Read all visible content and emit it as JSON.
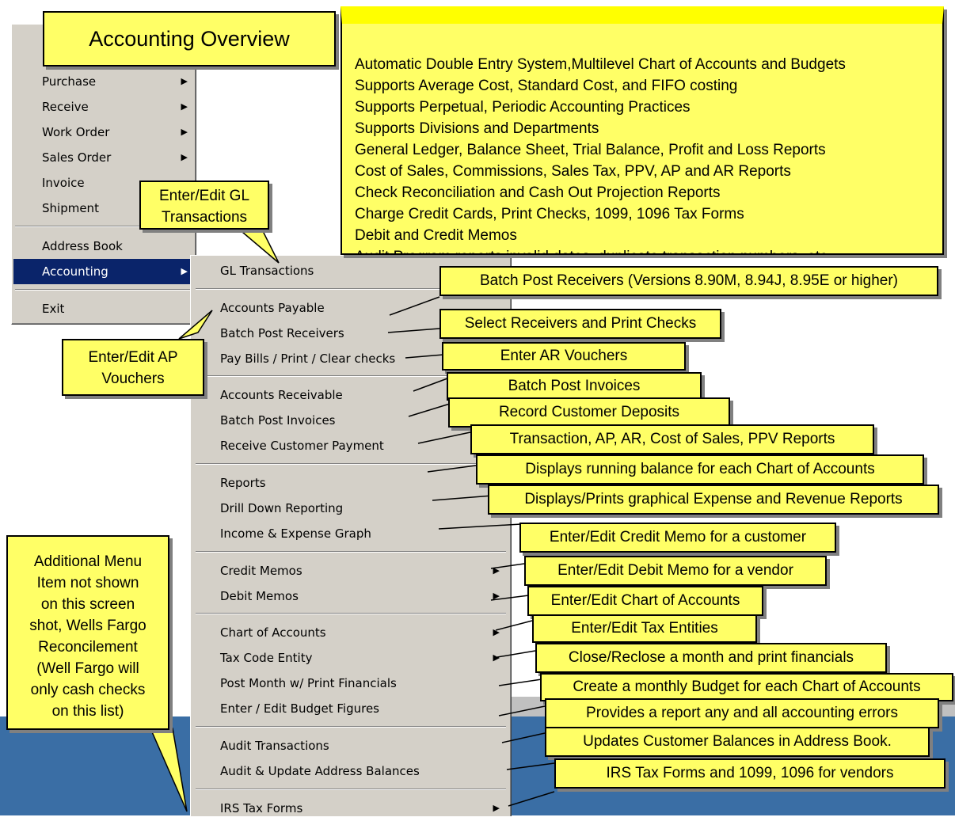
{
  "main_menu": {
    "items": [
      {
        "label": "Purchase",
        "arrow": "▶"
      },
      {
        "label": "Receive",
        "arrow": "▶"
      },
      {
        "label": "Work Order",
        "arrow": "▶"
      },
      {
        "label": "Sales Order",
        "arrow": "▶"
      },
      {
        "label": "Invoice",
        "arrow": ""
      },
      {
        "label": "Shipment",
        "arrow": ""
      },
      {
        "label": "Address Book",
        "arrow": ""
      },
      {
        "label": "Accounting",
        "arrow": "▶"
      },
      {
        "label": "Exit",
        "arrow": ""
      }
    ]
  },
  "submenu": {
    "items": [
      {
        "label": "GL Transactions",
        "arrow": ""
      },
      {
        "label": "Accounts Payable",
        "arrow": ""
      },
      {
        "label": "Batch Post Receivers",
        "arrow": ""
      },
      {
        "label": "Pay Bills / Print / Clear checks",
        "arrow": ""
      },
      {
        "label": "Accounts Receivable",
        "arrow": ""
      },
      {
        "label": "Batch Post Invoices",
        "arrow": ""
      },
      {
        "label": "Receive Customer Payment",
        "arrow": ""
      },
      {
        "label": "Reports",
        "arrow": ""
      },
      {
        "label": "Drill Down Reporting",
        "arrow": ""
      },
      {
        "label": "Income & Expense Graph",
        "arrow": ""
      },
      {
        "label": "Credit Memos",
        "arrow": "▶"
      },
      {
        "label": "Debit Memos",
        "arrow": "▶"
      },
      {
        "label": "Chart of Accounts",
        "arrow": "▶"
      },
      {
        "label": "Tax Code Entity",
        "arrow": "▶"
      },
      {
        "label": "Post Month w/ Print Financials",
        "arrow": ""
      },
      {
        "label": "Enter / Edit Budget Figures",
        "arrow": ""
      },
      {
        "label": "Audit Transactions",
        "arrow": ""
      },
      {
        "label": "Audit & Update Address Balances",
        "arrow": ""
      },
      {
        "label": "IRS Tax Forms",
        "arrow": "▶"
      }
    ]
  },
  "callouts": {
    "title": "Accounting Overview",
    "features": [
      "Automatic Double Entry System,Multilevel Chart of Accounts and Budgets",
      "Supports Average Cost, Standard Cost, and FIFO costing",
      "Supports Perpetual, Periodic Accounting Practices",
      "Supports Divisions and Departments",
      "General Ledger, Balance Sheet, Trial Balance, Profit and Loss Reports",
      "Cost of Sales, Commissions, Sales Tax, PPV, AP and AR Reports",
      "Check Reconciliation and Cash Out Projection Reports",
      "Charge Credit Cards, Print Checks, 1099, 1096 Tax Forms",
      "Debit and Credit Memos",
      "Audit Program reports invalid dates, duplicate transaction numbers, etc."
    ],
    "gl_line1": "Enter/Edit GL",
    "gl_line2": "Transactions",
    "ap_line1": "Enter/Edit AP",
    "ap_line2": "Vouchers",
    "additional": [
      "Additional Menu",
      "Item not shown",
      "on this screen",
      "shot, Wells Fargo",
      "Reconcilement",
      "(Well Fargo will",
      "only cash checks",
      "on this list)"
    ],
    "right": [
      "Batch Post Receivers (Versions 8.90M, 8.94J, 8.95E or higher)",
      "Select Receivers and Print Checks",
      "Enter AR Vouchers",
      "Batch Post Invoices",
      "Record Customer Deposits",
      "Transaction, AP, AR, Cost of Sales, PPV Reports",
      "Displays running balance for each Chart of Accounts",
      "Displays/Prints graphical Expense and Revenue Reports",
      "Enter/Edit Credit Memo for a customer",
      "Enter/Edit Debit Memo for a vendor",
      "Enter/Edit Chart of Accounts",
      "Enter/Edit Tax Entities",
      "Close/Reclose a month and print financials",
      "Create a monthly Budget for each Chart of Accounts",
      "Provides a report any and all accounting errors",
      "Updates Customer Balances in Address Book.",
      "IRS Tax Forms and 1099, 1096 for vendors"
    ]
  }
}
